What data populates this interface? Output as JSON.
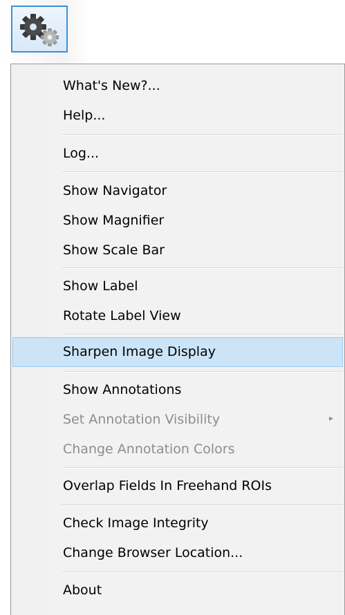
{
  "toolbar": {
    "icon": "gears-icon"
  },
  "menu": {
    "items": [
      {
        "label": "What's New?...",
        "enabled": true
      },
      {
        "label": "Help...",
        "enabled": true
      },
      {
        "label": "Log...",
        "enabled": true
      },
      {
        "label": "Show Navigator",
        "enabled": true
      },
      {
        "label": "Show Magnifier",
        "enabled": true
      },
      {
        "label": "Show Scale Bar",
        "enabled": true
      },
      {
        "label": "Show Label",
        "enabled": true
      },
      {
        "label": "Rotate Label View",
        "enabled": true
      },
      {
        "label": "Sharpen Image Display",
        "enabled": true,
        "highlighted": true
      },
      {
        "label": "Show Annotations",
        "enabled": true
      },
      {
        "label": "Set Annotation Visibility",
        "enabled": false,
        "has_submenu": true
      },
      {
        "label": "Change Annotation Colors",
        "enabled": false
      },
      {
        "label": "Overlap Fields In Freehand ROIs",
        "enabled": true
      },
      {
        "label": "Check Image Integrity",
        "enabled": true
      },
      {
        "label": "Change Browser Location...",
        "enabled": true
      },
      {
        "label": "About",
        "enabled": true
      }
    ],
    "submenu_arrow": "▸",
    "highlight_color": "#cce4f7",
    "disabled_color": "#8d8d8d"
  }
}
